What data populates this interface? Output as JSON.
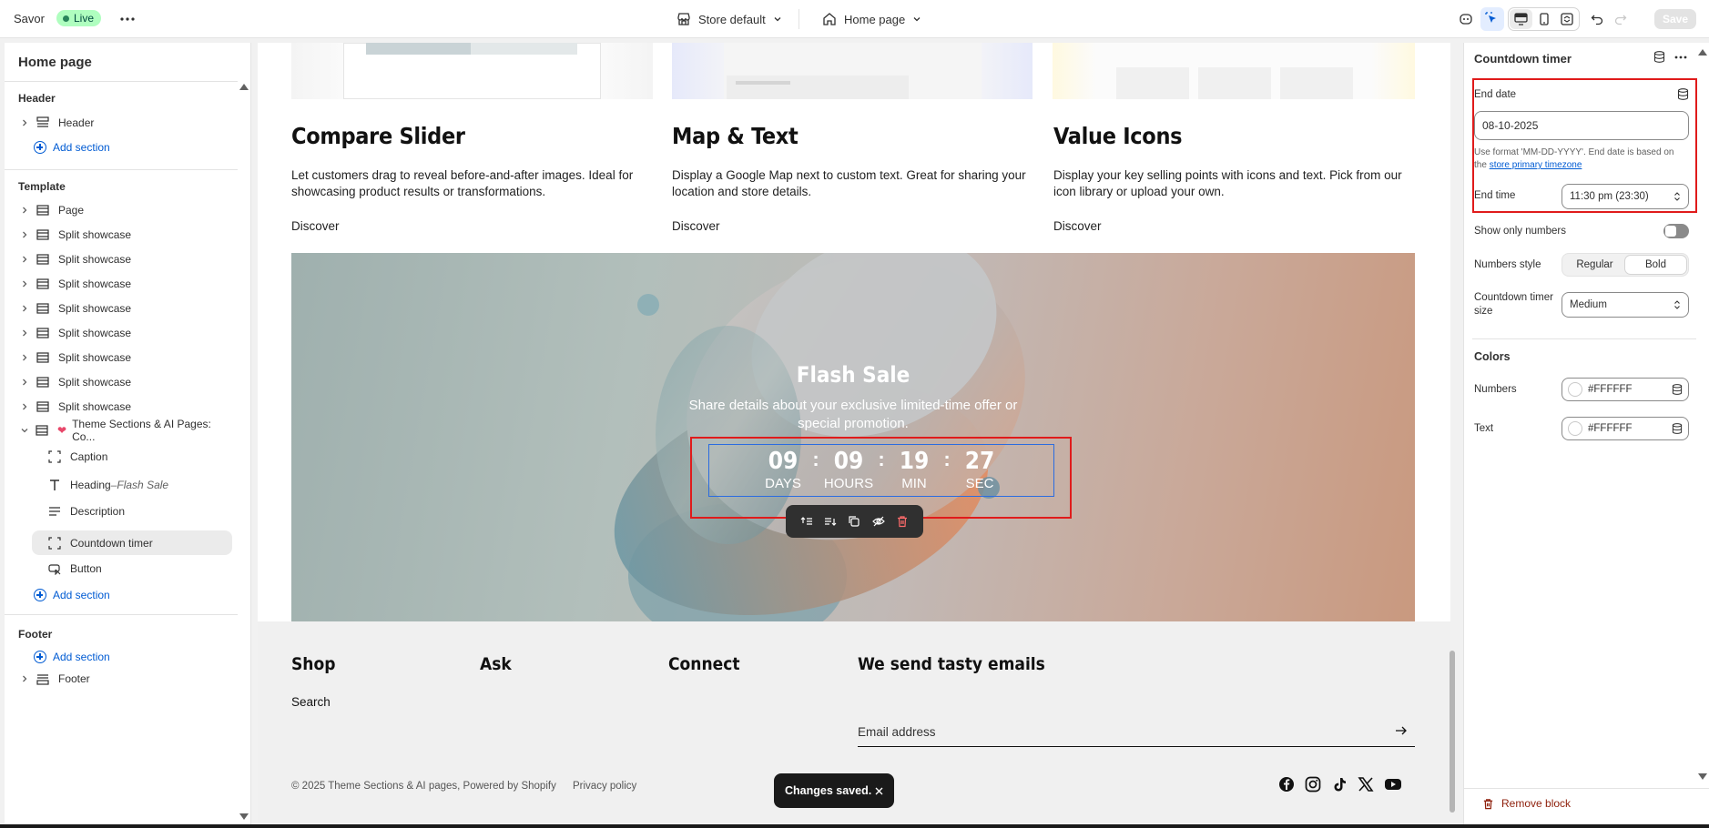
{
  "topbar": {
    "store_name": "Savor",
    "live_label": "Live",
    "theme_select": "Store default",
    "page_select": "Home page",
    "save_label": "Save"
  },
  "sidebar": {
    "title": "Home page",
    "header_group": "Header",
    "header_item": "Header",
    "add_section": "Add section",
    "template_group": "Template",
    "template_items": [
      "Page",
      "Split showcase",
      "Split showcase",
      "Split showcase",
      "Split showcase",
      "Split showcase",
      "Split showcase",
      "Split showcase",
      "Split showcase"
    ],
    "expanded_section": "Theme Sections & AI Pages: Co...",
    "blocks": {
      "caption": "Caption",
      "heading": "Heading",
      "heading_dash": " – ",
      "heading_sub": "Flash Sale",
      "description": "Description",
      "countdown": "Countdown timer",
      "button": "Button"
    },
    "footer_group": "Footer",
    "footer_item": "Footer"
  },
  "preview": {
    "cards": [
      {
        "title": "Compare Slider",
        "desc": "Let customers drag to reveal before-and-after images. Ideal for showcasing product results or transformations.",
        "link": "Discover"
      },
      {
        "title": "Map & Text",
        "desc": "Display a Google Map next to custom text. Great for sharing your location and store details.",
        "link": "Discover"
      },
      {
        "title": "Value Icons",
        "desc": "Display your key selling points with icons and text. Pick from our icon library or upload your own.",
        "link": "Discover"
      }
    ],
    "hero": {
      "title": "Flash Sale",
      "subtitle": "Share details about your exclusive limited-time offer or special promotion.",
      "timer": [
        {
          "num": "09",
          "label": "DAYS"
        },
        {
          "num": "09",
          "label": "HOURS"
        },
        {
          "num": "19",
          "label": "MIN"
        },
        {
          "num": "27",
          "label": "SEC"
        }
      ],
      "separator": ":"
    },
    "footer": {
      "col_shop": "Shop",
      "col_ask": "Ask",
      "col_connect": "Connect",
      "col_email": "We send tasty emails",
      "shop_link": "Search",
      "email_placeholder": "Email address",
      "copyright": "© 2025 Theme Sections & AI pages, Powered by Shopify",
      "privacy": "Privacy policy"
    },
    "toast": "Changes saved."
  },
  "settings": {
    "title": "Countdown timer",
    "end_date_label": "End date",
    "end_date_value": "08-10-2025",
    "help_text": "Use format 'MM-DD-YYYY'. End date is based on the ",
    "help_link": "store primary timezone",
    "end_time_label": "End time",
    "end_time_value": "11:30 pm (23:30)",
    "show_only_numbers_label": "Show only numbers",
    "numbers_style_label": "Numbers style",
    "numbers_style_options": [
      "Regular",
      "Bold"
    ],
    "numbers_style_selected": "Bold",
    "timer_size_label": "Countdown timer size",
    "timer_size_value": "Medium",
    "colors_heading": "Colors",
    "numbers_label": "Numbers",
    "numbers_color": "#FFFFFF",
    "text_label": "Text",
    "text_color": "#FFFFFF",
    "remove_label": "Remove block"
  },
  "colors": {
    "accent": "#005bd3",
    "highlight": "#e01b1b",
    "danger": "#8e1f0b"
  }
}
